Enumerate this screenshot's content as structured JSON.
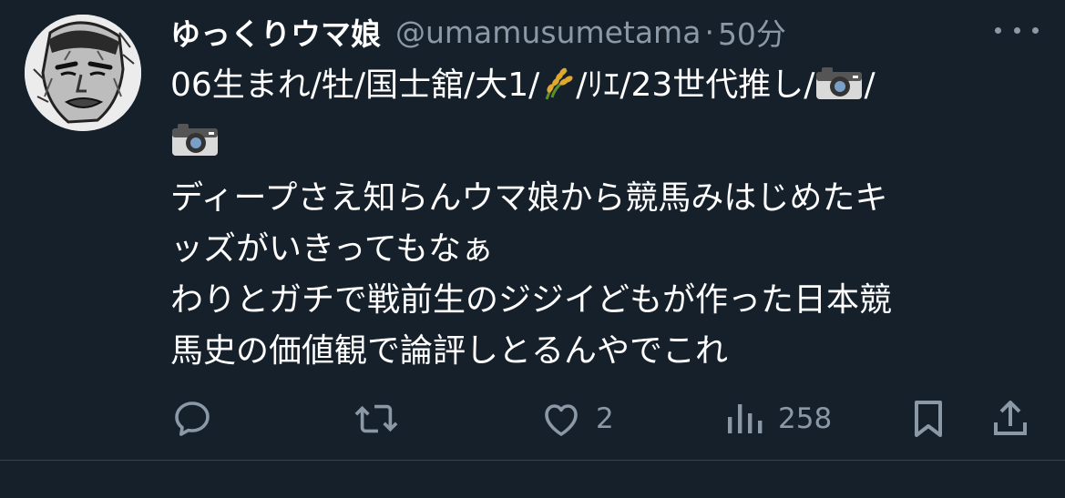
{
  "tweet": {
    "author": {
      "display_name": "ゆっくりウマ娘",
      "handle": "@umamusumetama",
      "avatar_icon": "avatar-manga-face"
    },
    "separator": "·",
    "time": "50分",
    "more_icon": "more-horizontal-icon",
    "bio_line1_a": "06生まれ/牡/国士舘/大1/",
    "bio_line1_b": "/ﾘｴ/23世代推し/",
    "bio_line1_c": "/",
    "text_lines": [
      "ディープさえ知らんウマ娘から競馬みはじめたキ",
      "ッズがいきってもなぁ",
      "わりとガチで戦前生のジジイどもが作った日本競",
      "馬史の価値観で論評しとるんやでこれ"
    ],
    "actions": {
      "reply": {
        "icon": "reply-icon",
        "count": ""
      },
      "retweet": {
        "icon": "retweet-icon",
        "count": ""
      },
      "like": {
        "icon": "heart-icon",
        "count": "2"
      },
      "views": {
        "icon": "views-icon",
        "count": "258"
      },
      "bookmark": {
        "icon": "bookmark-icon"
      },
      "share": {
        "icon": "share-icon"
      }
    },
    "colors": {
      "background": "#15202b",
      "text": "#ffffff",
      "secondary": "#8b98a5"
    }
  }
}
